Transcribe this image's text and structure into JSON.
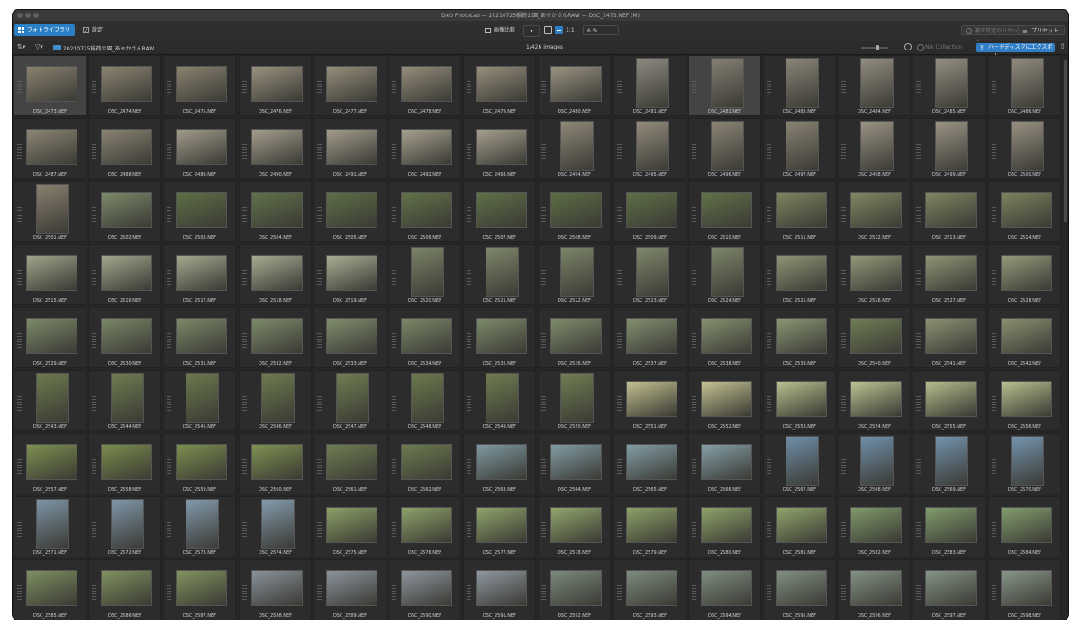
{
  "window": {
    "title": "DxO PhotoLab — 20210725稲荷公園_あやかさんRAW — DSC_2473.NEF (M)"
  },
  "toolbar": {
    "tab_library": "フォトライブラリ",
    "tab_settings": "設定",
    "compare_label": "画像比較",
    "ratio_label": "1:1",
    "zoom_value": "6 %",
    "reset_label": "補正設定のリセット",
    "presets_label": "プリセット"
  },
  "pathbar": {
    "folder_name": "20210725稲荷公園_あやかさんRAW",
    "image_count": "1/426 images",
    "nik_label": "Nik Collection",
    "export_label": "ハードディスクにエクスポート"
  },
  "accent_color": "#2b7fc4",
  "grid": {
    "start_number": 2473,
    "files": [
      {
        "name": "DSC_2473.NEF",
        "o": "l",
        "c": "#8a8270"
      },
      {
        "name": "DSC_2474.NEF",
        "o": "l",
        "c": "#8c8472"
      },
      {
        "name": "DSC_2475.NEF",
        "o": "l",
        "c": "#8b8371"
      },
      {
        "name": "DSC_2476.NEF",
        "o": "l",
        "c": "#9a9280"
      },
      {
        "name": "DSC_2477.NEF",
        "o": "l",
        "c": "#968e7c"
      },
      {
        "name": "DSC_2478.NEF",
        "o": "l",
        "c": "#958d7b"
      },
      {
        "name": "DSC_2479.NEF",
        "o": "l",
        "c": "#978f7d"
      },
      {
        "name": "DSC_2480.NEF",
        "o": "l",
        "c": "#9a9382"
      },
      {
        "name": "DSC_2481.NEF",
        "o": "p",
        "c": "#8d8a80"
      },
      {
        "name": "DSC_2482.NEF",
        "o": "p",
        "c": "#857f73"
      },
      {
        "name": "DSC_2483.NEF",
        "o": "p",
        "c": "#8a8578"
      },
      {
        "name": "DSC_2484.NEF",
        "o": "p",
        "c": "#938d80"
      },
      {
        "name": "DSC_2485.NEF",
        "o": "p",
        "c": "#958f82"
      },
      {
        "name": "DSC_2486.NEF",
        "o": "p",
        "c": "#918b7e"
      },
      {
        "name": "DSC_2487.NEF",
        "o": "l",
        "c": "#8d8675"
      },
      {
        "name": "DSC_2488.NEF",
        "o": "l",
        "c": "#8b8474"
      },
      {
        "name": "DSC_2489.NEF",
        "o": "l",
        "c": "#a39c8c"
      },
      {
        "name": "DSC_2490.NEF",
        "o": "l",
        "c": "#a59e8e"
      },
      {
        "name": "DSC_2491.NEF",
        "o": "l",
        "c": "#a49d8d"
      },
      {
        "name": "DSC_2492.NEF",
        "o": "l",
        "c": "#a8a190"
      },
      {
        "name": "DSC_2493.NEF",
        "o": "l",
        "c": "#a7a08f"
      },
      {
        "name": "DSC_2494.NEF",
        "o": "p",
        "c": "#8f8878"
      },
      {
        "name": "DSC_2495.NEF",
        "o": "p",
        "c": "#938c7c"
      },
      {
        "name": "DSC_2496.NEF",
        "o": "p",
        "c": "#8c8576"
      },
      {
        "name": "DSC_2497.NEF",
        "o": "p",
        "c": "#8a8374"
      },
      {
        "name": "DSC_2498.NEF",
        "o": "p",
        "c": "#9a9384"
      },
      {
        "name": "DSC_2499.NEF",
        "o": "p",
        "c": "#9b9485"
      },
      {
        "name": "DSC_2500.NEF",
        "o": "p",
        "c": "#989182"
      },
      {
        "name": "DSC_2501.NEF",
        "o": "p",
        "c": "#8a8070"
      },
      {
        "name": "DSC_2502.NEF",
        "o": "l",
        "c": "#7c8a6a"
      },
      {
        "name": "DSC_2503.NEF",
        "o": "l",
        "c": "#5f7046"
      },
      {
        "name": "DSC_2504.NEF",
        "o": "l",
        "c": "#61724a"
      },
      {
        "name": "DSC_2505.NEF",
        "o": "l",
        "c": "#5e6f47"
      },
      {
        "name": "DSC_2506.NEF",
        "o": "l",
        "c": "#627349"
      },
      {
        "name": "DSC_2507.NEF",
        "o": "l",
        "c": "#607148"
      },
      {
        "name": "DSC_2508.NEF",
        "o": "l",
        "c": "#5d6e45"
      },
      {
        "name": "DSC_2509.NEF",
        "o": "l",
        "c": "#5f7047"
      },
      {
        "name": "DSC_2510.NEF",
        "o": "l",
        "c": "#627249"
      },
      {
        "name": "DSC_2511.NEF",
        "o": "l",
        "c": "#7d8560"
      },
      {
        "name": "DSC_2512.NEF",
        "o": "l",
        "c": "#808862"
      },
      {
        "name": "DSC_2513.NEF",
        "o": "l",
        "c": "#7e8661"
      },
      {
        "name": "DSC_2514.NEF",
        "o": "l",
        "c": "#7b835e"
      },
      {
        "name": "DSC_2515.NEF",
        "o": "l",
        "c": "#9ea58a"
      },
      {
        "name": "DSC_2516.NEF",
        "o": "l",
        "c": "#a1a88d"
      },
      {
        "name": "DSC_2517.NEF",
        "o": "l",
        "c": "#a3aa8f"
      },
      {
        "name": "DSC_2518.NEF",
        "o": "l",
        "c": "#a6ad92"
      },
      {
        "name": "DSC_2519.NEF",
        "o": "l",
        "c": "#a8af94"
      },
      {
        "name": "DSC_2520.NEF",
        "o": "p",
        "c": "#7c8468"
      },
      {
        "name": "DSC_2521.NEF",
        "o": "p",
        "c": "#7f876b"
      },
      {
        "name": "DSC_2522.NEF",
        "o": "p",
        "c": "#7d8569"
      },
      {
        "name": "DSC_2523.NEF",
        "o": "p",
        "c": "#80886c"
      },
      {
        "name": "DSC_2524.NEF",
        "o": "p",
        "c": "#7e866a"
      },
      {
        "name": "DSC_2525.NEF",
        "o": "l",
        "c": "#8f9676"
      },
      {
        "name": "DSC_2526.NEF",
        "o": "l",
        "c": "#929979"
      },
      {
        "name": "DSC_2527.NEF",
        "o": "l",
        "c": "#8e9575"
      },
      {
        "name": "DSC_2528.NEF",
        "o": "l",
        "c": "#949b7b"
      },
      {
        "name": "DSC_2529.NEF",
        "o": "l",
        "c": "#7d8a6a"
      },
      {
        "name": "DSC_2530.NEF",
        "o": "l",
        "c": "#7a8767"
      },
      {
        "name": "DSC_2531.NEF",
        "o": "l",
        "c": "#7c8969"
      },
      {
        "name": "DSC_2532.NEF",
        "o": "l",
        "c": "#7e8b6b"
      },
      {
        "name": "DSC_2533.NEF",
        "o": "l",
        "c": "#818e6e"
      },
      {
        "name": "DSC_2534.NEF",
        "o": "l",
        "c": "#7b8868"
      },
      {
        "name": "DSC_2535.NEF",
        "o": "l",
        "c": "#7d8a6a"
      },
      {
        "name": "DSC_2536.NEF",
        "o": "l",
        "c": "#7f8c6c"
      },
      {
        "name": "DSC_2537.NEF",
        "o": "l",
        "c": "#838f70"
      },
      {
        "name": "DSC_2538.NEF",
        "o": "l",
        "c": "#85916f"
      },
      {
        "name": "DSC_2539.NEF",
        "o": "l",
        "c": "#8a9674"
      },
      {
        "name": "DSC_2540.NEF",
        "o": "l",
        "c": "#6f7d55"
      },
      {
        "name": "DSC_2541.NEF",
        "o": "l",
        "c": "#8c9273"
      },
      {
        "name": "DSC_2542.NEF",
        "o": "l",
        "c": "#8a9070"
      },
      {
        "name": "DSC_2543.NEF",
        "o": "p",
        "c": "#6c7a4e"
      },
      {
        "name": "DSC_2544.NEF",
        "o": "p",
        "c": "#6e7c50"
      },
      {
        "name": "DSC_2545.NEF",
        "o": "p",
        "c": "#6b794d"
      },
      {
        "name": "DSC_2546.NEF",
        "o": "p",
        "c": "#6d7b4f"
      },
      {
        "name": "DSC_2547.NEF",
        "o": "p",
        "c": "#6f7d51"
      },
      {
        "name": "DSC_2548.NEF",
        "o": "p",
        "c": "#6c7a4e"
      },
      {
        "name": "DSC_2549.NEF",
        "o": "p",
        "c": "#6e7c50"
      },
      {
        "name": "DSC_2550.NEF",
        "o": "p",
        "c": "#707e52"
      },
      {
        "name": "DSC_2551.NEF",
        "o": "l",
        "c": "#c2c08f"
      },
      {
        "name": "DSC_2552.NEF",
        "o": "l",
        "c": "#c4c291"
      },
      {
        "name": "DSC_2553.NEF",
        "o": "l",
        "c": "#b9c08e"
      },
      {
        "name": "DSC_2554.NEF",
        "o": "l",
        "c": "#bcc391"
      },
      {
        "name": "DSC_2555.NEF",
        "o": "l",
        "c": "#b5bd8b"
      },
      {
        "name": "DSC_2556.NEF",
        "o": "l",
        "c": "#b8c08e"
      },
      {
        "name": "DSC_2557.NEF",
        "o": "l",
        "c": "#7e9050"
      },
      {
        "name": "DSC_2558.NEF",
        "o": "l",
        "c": "#7b8d4d"
      },
      {
        "name": "DSC_2559.NEF",
        "o": "l",
        "c": "#7d8f4f"
      },
      {
        "name": "DSC_2560.NEF",
        "o": "l",
        "c": "#809252"
      },
      {
        "name": "DSC_2561.NEF",
        "o": "l",
        "c": "#6f7d52"
      },
      {
        "name": "DSC_2562.NEF",
        "o": "l",
        "c": "#6d7b50"
      },
      {
        "name": "DSC_2563.NEF",
        "o": "l",
        "c": "#7f9aa3"
      },
      {
        "name": "DSC_2564.NEF",
        "o": "l",
        "c": "#819ca5"
      },
      {
        "name": "DSC_2565.NEF",
        "o": "l",
        "c": "#839ea7"
      },
      {
        "name": "DSC_2566.NEF",
        "o": "l",
        "c": "#85a0a9"
      },
      {
        "name": "DSC_2567.NEF",
        "o": "p",
        "c": "#6f8ea8"
      },
      {
        "name": "DSC_2568.NEF",
        "o": "p",
        "c": "#7190aa"
      },
      {
        "name": "DSC_2569.NEF",
        "o": "p",
        "c": "#7392ac"
      },
      {
        "name": "DSC_2570.NEF",
        "o": "p",
        "c": "#7594ae"
      },
      {
        "name": "DSC_2571.NEF",
        "o": "p",
        "c": "#7d94a6"
      },
      {
        "name": "DSC_2572.NEF",
        "o": "p",
        "c": "#7f96a8"
      },
      {
        "name": "DSC_2573.NEF",
        "o": "p",
        "c": "#8198aa"
      },
      {
        "name": "DSC_2574.NEF",
        "o": "p",
        "c": "#839aac"
      },
      {
        "name": "DSC_2575.NEF",
        "o": "l",
        "c": "#8ca067"
      },
      {
        "name": "DSC_2576.NEF",
        "o": "l",
        "c": "#8ea269"
      },
      {
        "name": "DSC_2577.NEF",
        "o": "l",
        "c": "#90a46b"
      },
      {
        "name": "DSC_2578.NEF",
        "o": "l",
        "c": "#92a66d"
      },
      {
        "name": "DSC_2579.NEF",
        "o": "l",
        "c": "#8da168"
      },
      {
        "name": "DSC_2580.NEF",
        "o": "l",
        "c": "#8fa36a"
      },
      {
        "name": "DSC_2581.NEF",
        "o": "l",
        "c": "#91a56c"
      },
      {
        "name": "DSC_2582.NEF",
        "o": "l",
        "c": "#7f9a6a"
      },
      {
        "name": "DSC_2583.NEF",
        "o": "l",
        "c": "#819c6c"
      },
      {
        "name": "DSC_2584.NEF",
        "o": "l",
        "c": "#839e6e"
      },
      {
        "name": "DSC_2585.NEF",
        "o": "l",
        "c": "#7e8f61"
      },
      {
        "name": "DSC_2586.NEF",
        "o": "l",
        "c": "#80915f"
      },
      {
        "name": "DSC_2587.NEF",
        "o": "l",
        "c": "#82935f"
      },
      {
        "name": "DSC_2588.NEF",
        "o": "l",
        "c": "#8a929a"
      },
      {
        "name": "DSC_2589.NEF",
        "o": "l",
        "c": "#8c949c"
      },
      {
        "name": "DSC_2590.NEF",
        "o": "l",
        "c": "#8e969e"
      },
      {
        "name": "DSC_2591.NEF",
        "o": "l",
        "c": "#9098a0"
      },
      {
        "name": "DSC_2592.NEF",
        "o": "l",
        "c": "#7c8a7d"
      },
      {
        "name": "DSC_2593.NEF",
        "o": "l",
        "c": "#7e8c7f"
      },
      {
        "name": "DSC_2594.NEF",
        "o": "l",
        "c": "#808e81"
      },
      {
        "name": "DSC_2595.NEF",
        "o": "l",
        "c": "#829083"
      },
      {
        "name": "DSC_2596.NEF",
        "o": "l",
        "c": "#849285"
      },
      {
        "name": "DSC_2597.NEF",
        "o": "l",
        "c": "#869487"
      },
      {
        "name": "DSC_2598.NEF",
        "o": "l",
        "c": "#889689"
      }
    ]
  }
}
